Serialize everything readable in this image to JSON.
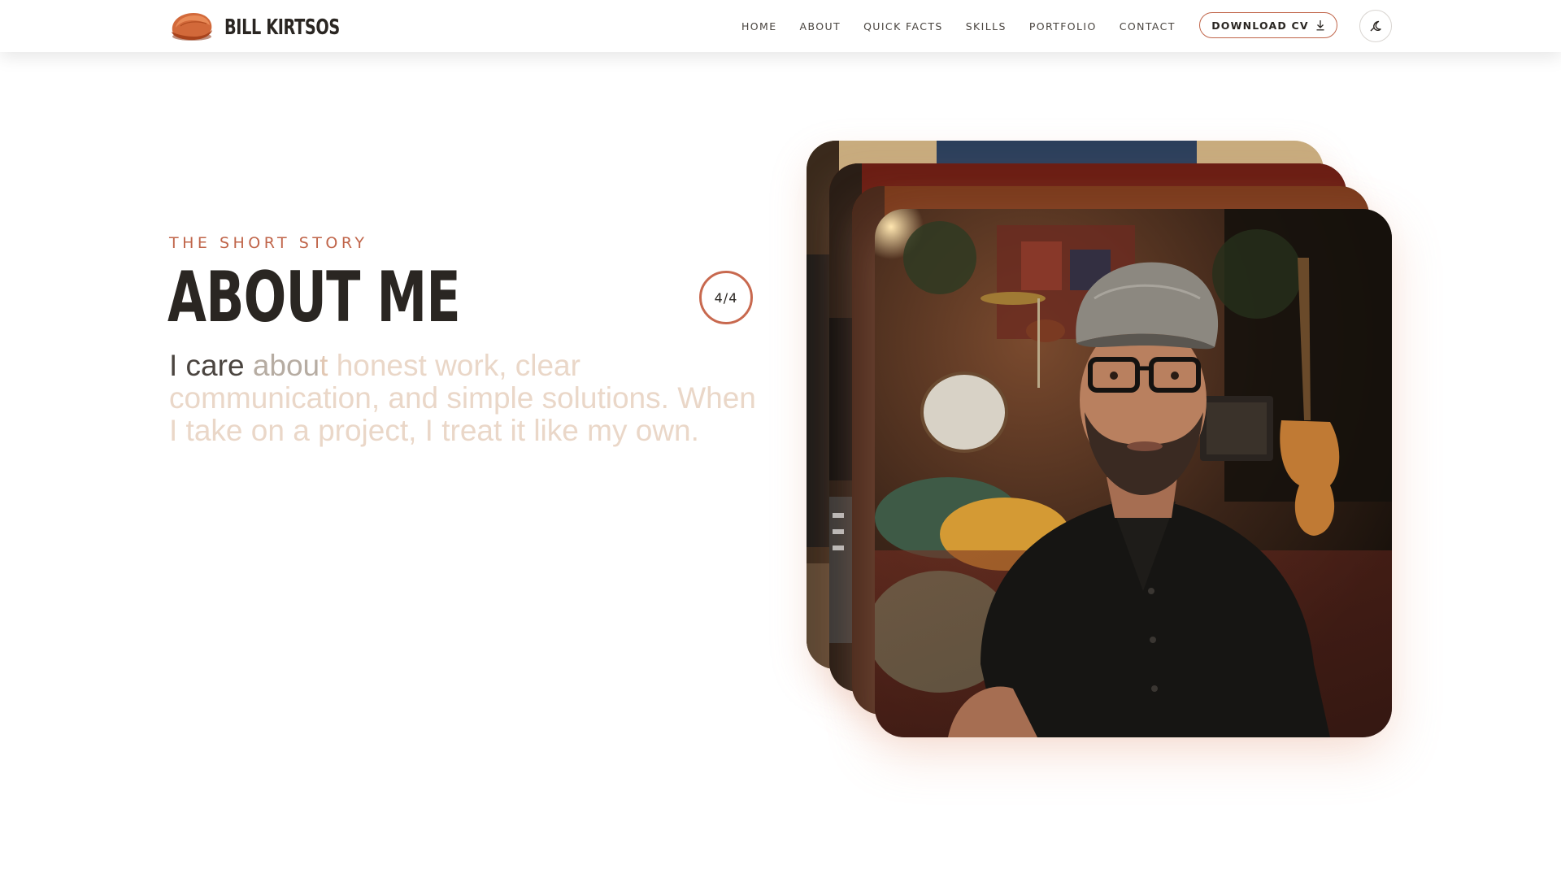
{
  "brand": {
    "name": "BILL KIRTSOS",
    "logo_icon": "flat-cap-icon",
    "accent_color": "#c0654a"
  },
  "nav": {
    "items": [
      {
        "label": "HOME"
      },
      {
        "label": "ABOUT"
      },
      {
        "label": "QUICK FACTS"
      },
      {
        "label": "SKILLS"
      },
      {
        "label": "PORTFOLIO"
      },
      {
        "label": "CONTACT"
      }
    ]
  },
  "header_actions": {
    "cv_label": "DOWNLOAD CV",
    "cv_icon": "download-icon",
    "mode_icon": "moon-icon"
  },
  "about": {
    "kicker": "THE SHORT STORY",
    "title": "ABOUT ME",
    "counter": "4/4",
    "lead_part_1": "I care ",
    "lead_part_2": "abou",
    "lead_part_3": "t",
    "lead_part_4": " honest work, clear communication, and simple solutions. When I take on a project, I treat it like my own."
  },
  "photos": [
    {
      "name": "photo-card-1",
      "subject": "studio wall"
    },
    {
      "name": "photo-card-2",
      "subject": "studio gear"
    },
    {
      "name": "photo-card-3",
      "subject": "studio room"
    },
    {
      "name": "photo-card-4",
      "subject": "portrait of man in flat cap and glasses in music studio"
    }
  ]
}
